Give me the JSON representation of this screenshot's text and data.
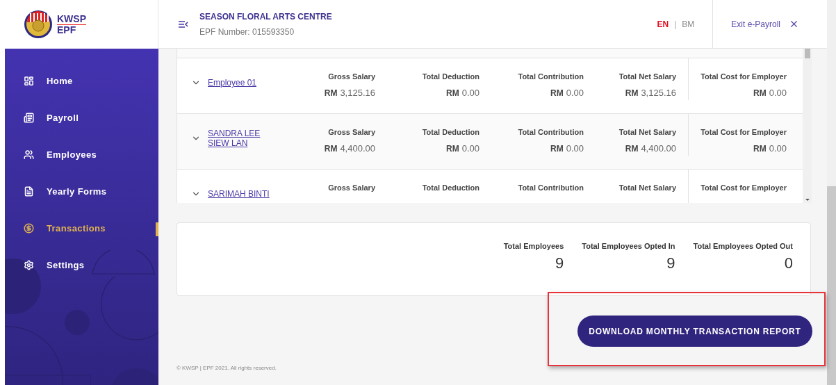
{
  "logo": {
    "line1": "KWSP",
    "line2": "EPF"
  },
  "header": {
    "company": "SEASON FLORAL ARTS CENTRE",
    "epf_number": "EPF Number: 015593350",
    "languages": [
      {
        "label": "EN",
        "selected": true
      },
      {
        "label": "BM",
        "selected": false
      }
    ],
    "separator": "|",
    "exit": "Exit e-Payroll"
  },
  "sidebar": {
    "items": [
      {
        "label": "Home",
        "selected": false
      },
      {
        "label": "Payroll",
        "selected": false
      },
      {
        "label": "Employees",
        "selected": false
      },
      {
        "label": "Yearly Forms",
        "selected": false
      },
      {
        "label": "Transactions",
        "selected": true
      },
      {
        "label": "Settings",
        "selected": false
      }
    ]
  },
  "table": {
    "rows": [
      {
        "name": "Employee 01",
        "cells": [
          {
            "label": "Gross Salary",
            "currency": "RM",
            "amount": "3,125.16"
          },
          {
            "label": "Total Deduction",
            "currency": "RM",
            "amount": "0.00"
          },
          {
            "label": "Total Contribution",
            "currency": "RM",
            "amount": "0.00"
          },
          {
            "label": "Total Net Salary",
            "currency": "RM",
            "amount": "3,125.16"
          },
          {
            "label": "Total Cost for Employer",
            "currency": "RM",
            "amount": "0.00"
          }
        ]
      },
      {
        "name": "SANDRA LEE SIEW LAN",
        "cells": [
          {
            "label": "Gross Salary",
            "currency": "RM",
            "amount": "4,400.00"
          },
          {
            "label": "Total Deduction",
            "currency": "RM",
            "amount": "0.00"
          },
          {
            "label": "Total Contribution",
            "currency": "RM",
            "amount": "0.00"
          },
          {
            "label": "Total Net Salary",
            "currency": "RM",
            "amount": "4,400.00"
          },
          {
            "label": "Total Cost for Employer",
            "currency": "RM",
            "amount": "0.00"
          }
        ]
      },
      {
        "name": "SARIMAH BINTI",
        "cells": [
          {
            "label": "Gross Salary"
          },
          {
            "label": "Total Deduction"
          },
          {
            "label": "Total Contribution"
          },
          {
            "label": "Total Net Salary"
          },
          {
            "label": "Total Cost for Employer"
          }
        ]
      }
    ]
  },
  "summary": [
    {
      "label": "Total Employees",
      "value": "9"
    },
    {
      "label": "Total Employees Opted In",
      "value": "9"
    },
    {
      "label": "Total Employees Opted Out",
      "value": "0"
    }
  ],
  "download_button": "DOWNLOAD MONTHLY TRANSACTION REPORT",
  "footer": "© KWSP | EPF 2021. All rights reserved."
}
